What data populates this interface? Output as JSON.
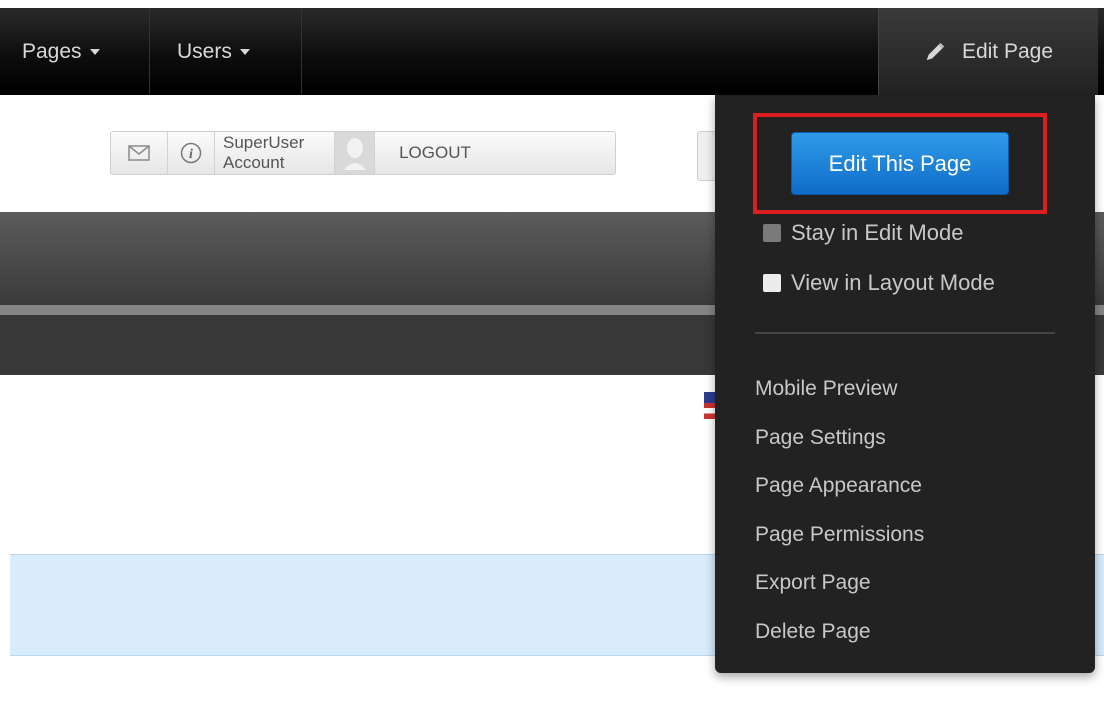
{
  "nav": {
    "pages_label": "Pages",
    "users_label": "Users",
    "edit_page_label": "Edit Page"
  },
  "userbar": {
    "account_label": "SuperUser Account",
    "logout_label": "LOGOUT"
  },
  "dropdown": {
    "edit_this_page_label": "Edit This Page",
    "stay_in_edit_mode_label": "Stay in Edit Mode",
    "view_in_layout_mode_label": "View in Layout Mode",
    "menu_items": [
      "Mobile Preview",
      "Page Settings",
      "Page Appearance",
      "Page Permissions",
      "Export Page",
      "Delete Page"
    ]
  },
  "colors": {
    "accent_blue": "#1a7fd6",
    "highlight_red": "#dd1e1e",
    "dropdown_bg": "#222222"
  },
  "icons": [
    "pencil-icon",
    "mail-icon",
    "info-icon",
    "avatar-icon",
    "caret-down-icon"
  ]
}
